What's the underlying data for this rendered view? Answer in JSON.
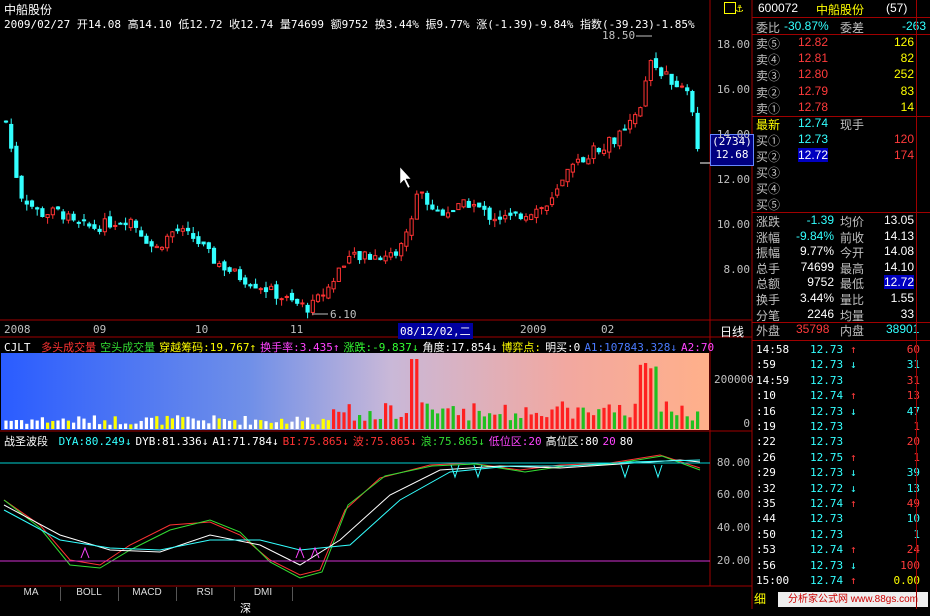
{
  "window_title": "中船股份",
  "header_info": {
    "date": "2009/02/27",
    "open": "开14.08",
    "high": "高14.10",
    "low": "低12.72",
    "close": "收12.74",
    "volume": "量74699",
    "amount": "额9752",
    "turnover": "换3.44%",
    "amplitude": "振9.77%",
    "change": "涨(-1.39)-9.84%",
    "index": "指数(-39.23)-1.85%"
  },
  "price_chart": {
    "y_ticks": [
      "18.00",
      "16.00",
      "14.00",
      "12.00",
      "10.00",
      "8.00"
    ],
    "x_ticks": [
      "2008",
      "09",
      "10",
      "11",
      "08/12/02,二",
      "2009",
      "02"
    ],
    "high_marker": "18.50",
    "low_marker": "6.10",
    "cursor_box_top": "(2734)",
    "cursor_box_price": "12.68",
    "period_label": "日线",
    "colors": {
      "up": "#ff3333",
      "down": "#33ffff",
      "bg": "#000000",
      "grid": "#a00000"
    }
  },
  "volume_panel": {
    "title": "CJLT",
    "labels": [
      {
        "text": "多头成交量",
        "color": "#ff3333"
      },
      {
        "text": "空头成交量",
        "color": "#33dd33"
      },
      {
        "text": "穿越筹码:19.767↑",
        "color": "#ffff00"
      },
      {
        "text": "换手率:3.435↑",
        "color": "#ff44ff"
      },
      {
        "text": "涨跌:-9.837↓",
        "color": "#33ff33"
      },
      {
        "text": "角度:17.854↓",
        "color": "#ffffff"
      },
      {
        "text": "博弈点:",
        "color": "#ffff00"
      },
      {
        "text": "明买:0",
        "color": "#ffffff"
      },
      {
        "text": "A1:107843.328↓",
        "color": "#4a7bff"
      },
      {
        "text": "A2:70",
        "color": "#ff44ff"
      }
    ],
    "y_ticks": [
      "200000",
      "0"
    ]
  },
  "wave_panel": {
    "title": "战圣波段",
    "labels": [
      {
        "text": "DYA:80.249↓",
        "color": "#33ffff"
      },
      {
        "text": "DYB:81.336↓",
        "color": "#ffffff"
      },
      {
        "text": "A1:71.784↓",
        "color": "#ffffff"
      },
      {
        "text": "BI:75.865↓",
        "color": "#ff3333"
      },
      {
        "text": "波:75.865↓",
        "color": "#ff3333"
      },
      {
        "text": "浪:75.865↓",
        "color": "#33dd33"
      },
      {
        "text": "低位区:20",
        "color": "#ff44ff"
      },
      {
        "text": "高位区:80",
        "color": "#ffffff"
      },
      {
        "text": "20",
        "color": "#ff44ff"
      },
      {
        "text": "80",
        "color": "#ffffff"
      }
    ],
    "y_ticks": [
      "80.00",
      "60.00",
      "40.00",
      "20.00"
    ]
  },
  "bottom_tabs": [
    "MA",
    "BOLL",
    "MACD",
    "RSI",
    "DMI"
  ],
  "bottom_status": "深",
  "right_panel": {
    "code": "600072",
    "name": "中船股份",
    "count": "(57)",
    "weibi_label": "委比",
    "weibi": "-30.87%",
    "weicha_label": "委差",
    "weicha": "-263",
    "sell": [
      {
        "label": "卖⑤",
        "price": "12.82",
        "vol": "126"
      },
      {
        "label": "卖④",
        "price": "12.81",
        "vol": "82"
      },
      {
        "label": "卖③",
        "price": "12.80",
        "vol": "252"
      },
      {
        "label": "卖②",
        "price": "12.79",
        "vol": "83"
      },
      {
        "label": "卖①",
        "price": "12.78",
        "vol": "14"
      }
    ],
    "latest_label": "最新",
    "latest": "12.74",
    "xianshou_label": "现手",
    "buy": [
      {
        "label": "买①",
        "price": "12.73",
        "vol": "120"
      },
      {
        "label": "买②",
        "price": "12.72",
        "vol": "174"
      },
      {
        "label": "买③",
        "price": "",
        "vol": ""
      },
      {
        "label": "买④",
        "price": "",
        "vol": ""
      },
      {
        "label": "买⑤",
        "price": "",
        "vol": ""
      }
    ],
    "stats": [
      {
        "l1": "涨跌",
        "v1": "-1.39",
        "l2": "均价",
        "v2": "13.05"
      },
      {
        "l1": "涨幅",
        "v1": "-9.84%",
        "l2": "前收",
        "v2": "14.13"
      },
      {
        "l1": "振幅",
        "v1": "9.77%",
        "l2": "今开",
        "v2": "14.08"
      },
      {
        "l1": "总手",
        "v1": "74699",
        "l2": "最高",
        "v2": "14.10"
      },
      {
        "l1": "总额",
        "v1": "9752",
        "l2": "最低",
        "v2": "12.72"
      },
      {
        "l1": "换手",
        "v1": "3.44%",
        "l2": "量比",
        "v2": "1.55"
      },
      {
        "l1": "分笔",
        "v1": "2246",
        "l2": "均量",
        "v2": "33"
      }
    ],
    "outer_label": "外盘",
    "outer": "35798",
    "inner_label": "内盘",
    "inner": "38901",
    "ticks": [
      {
        "t": "14:58",
        "p": "12.73",
        "d": "↑",
        "v": "60",
        "c": "red"
      },
      {
        "t": ":59",
        "p": "12.73",
        "d": "↓",
        "v": "31",
        "c": "cyan"
      },
      {
        "t": "14:59",
        "p": "12.73",
        "d": "",
        "v": "31",
        "c": "red"
      },
      {
        "t": ":10",
        "p": "12.74",
        "d": "↑",
        "v": "13",
        "c": "red"
      },
      {
        "t": ":16",
        "p": "12.73",
        "d": "↓",
        "v": "47",
        "c": "cyan"
      },
      {
        "t": ":19",
        "p": "12.73",
        "d": "",
        "v": "1",
        "c": "red"
      },
      {
        "t": ":22",
        "p": "12.73",
        "d": "",
        "v": "20",
        "c": "red"
      },
      {
        "t": ":26",
        "p": "12.75",
        "d": "↑",
        "v": "1",
        "c": "red"
      },
      {
        "t": ":29",
        "p": "12.73",
        "d": "↓",
        "v": "39",
        "c": "cyan"
      },
      {
        "t": ":32",
        "p": "12.72",
        "d": "↓",
        "v": "13",
        "c": "cyan"
      },
      {
        "t": ":35",
        "p": "12.74",
        "d": "↑",
        "v": "49",
        "c": "red"
      },
      {
        "t": ":44",
        "p": "12.73",
        "d": "",
        "v": "10",
        "c": "cyan"
      },
      {
        "t": ":50",
        "p": "12.73",
        "d": "",
        "v": "1",
        "c": "cyan"
      },
      {
        "t": ":53",
        "p": "12.74",
        "d": "↑",
        "v": "24",
        "c": "red"
      },
      {
        "t": ":56",
        "p": "12.73",
        "d": "↓",
        "v": "100",
        "c": "red"
      },
      {
        "t": "15:00",
        "p": "12.74",
        "d": "↑",
        "v": "0.00",
        "c": "yellow"
      }
    ],
    "footer_label": "细",
    "watermark": "分析家公式网 www.88gs.com"
  }
}
